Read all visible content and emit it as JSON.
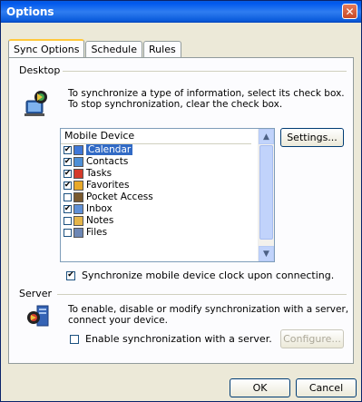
{
  "window": {
    "title": "Options"
  },
  "tabs": [
    "Sync Options",
    "Schedule",
    "Rules"
  ],
  "desktop": {
    "group_label": "Desktop",
    "info_line1": "To synchronize a type of information, select its check box.",
    "info_line2": "To stop synchronization, clear the check box.",
    "list_header": "Mobile Device",
    "settings_button": "Settings...",
    "items": [
      {
        "label": "Calendar",
        "checked": true,
        "selected": true,
        "icon": "calendar-icon"
      },
      {
        "label": "Contacts",
        "checked": true,
        "selected": false,
        "icon": "contacts-icon"
      },
      {
        "label": "Tasks",
        "checked": true,
        "selected": false,
        "icon": "tasks-icon"
      },
      {
        "label": "Favorites",
        "checked": true,
        "selected": false,
        "icon": "favorites-icon"
      },
      {
        "label": "Pocket Access",
        "checked": false,
        "selected": false,
        "icon": "pocket-access-icon"
      },
      {
        "label": "Inbox",
        "checked": true,
        "selected": false,
        "icon": "inbox-icon"
      },
      {
        "label": "Notes",
        "checked": false,
        "selected": false,
        "icon": "notes-icon"
      },
      {
        "label": "Files",
        "checked": false,
        "selected": false,
        "icon": "files-icon"
      }
    ],
    "clock_sync_label": "Synchronize mobile device clock upon connecting.",
    "clock_sync_checked": true
  },
  "server": {
    "group_label": "Server",
    "info_line1": "To enable, disable or modify synchronization with a server,",
    "info_line2": "connect your device.",
    "enable_label": "Enable synchronization with a server.",
    "enable_checked": false,
    "configure_button": "Configure..."
  },
  "footer": {
    "ok_button": "OK",
    "cancel_button": "Cancel"
  },
  "colors": {
    "titlebar": "#0a5bdc",
    "selection": "#316ac5",
    "dialog_bg": "#ece9d8"
  }
}
